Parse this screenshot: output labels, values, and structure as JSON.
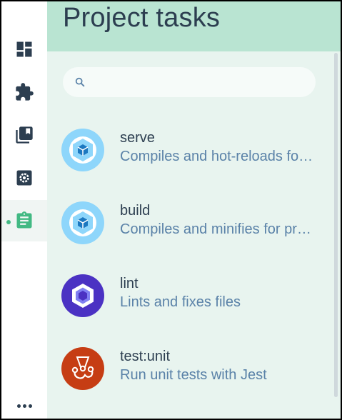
{
  "header": {
    "title": "Project tasks"
  },
  "search": {
    "placeholder": "",
    "value": ""
  },
  "sidebar": {
    "items": [
      {
        "name": "dashboard",
        "icon": "dashboard-icon",
        "active": false
      },
      {
        "name": "plugins",
        "icon": "puzzle-icon",
        "active": false
      },
      {
        "name": "dependencies",
        "icon": "library-books-icon",
        "active": false
      },
      {
        "name": "configuration",
        "icon": "settings-box-icon",
        "active": false
      },
      {
        "name": "tasks",
        "icon": "clipboard-icon",
        "active": true
      }
    ],
    "more_icon": "more-horiz-icon"
  },
  "tasks": [
    {
      "name": "serve",
      "description": "Compiles and hot-reloads for development",
      "icon": "webpack-icon"
    },
    {
      "name": "build",
      "description": "Compiles and minifies for production",
      "icon": "webpack-icon"
    },
    {
      "name": "lint",
      "description": "Lints and fixes files",
      "icon": "eslint-icon"
    },
    {
      "name": "test:unit",
      "description": "Run unit tests with Jest",
      "icon": "jest-icon"
    }
  ],
  "colors": {
    "accent": "#42b983",
    "header_bg": "#b9e4d2",
    "panel_bg": "#e8f4ef",
    "text_primary": "#2c3e50",
    "text_secondary": "#5a82a8",
    "webpack_bg": "#8ed6fb",
    "eslint_bg": "#4b32c3",
    "jest_bg": "#c63d14"
  }
}
